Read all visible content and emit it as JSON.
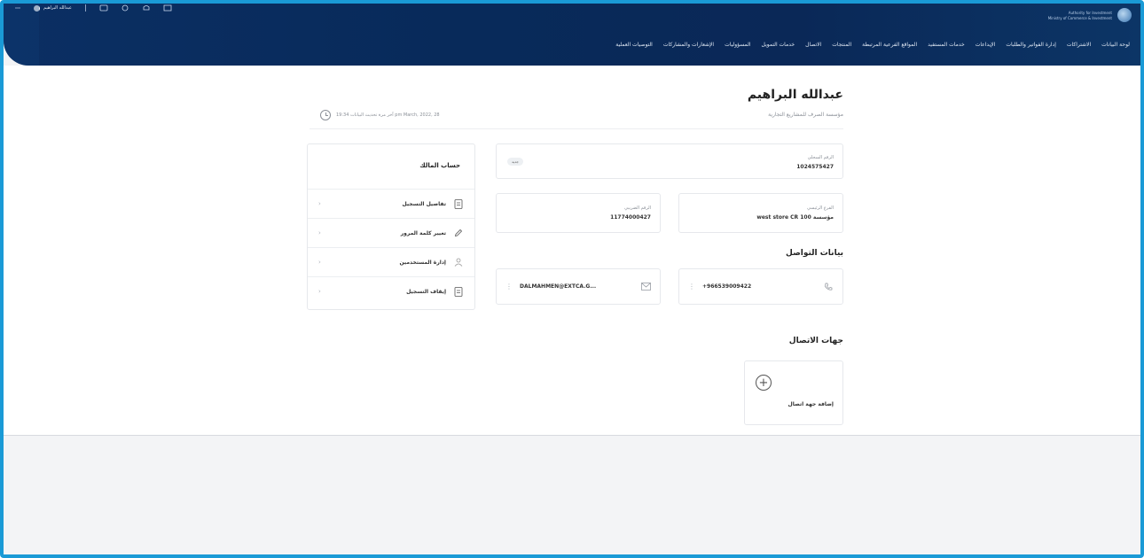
{
  "header": {
    "brand_lines": [
      "Authority for Investment",
      "Ministry of Commerce & Investment"
    ],
    "user_name": "عبدالله البراهيم",
    "nav": [
      "لوحة البيانات",
      "الاشتراكات",
      "إدارة الفواتير والطلبات",
      "الإيداعات",
      "خدمات المستفيد",
      "المواقع الفرعية المرتبطة",
      "المنتجات",
      "الاتصال",
      "خدمات التمويل",
      "المسؤوليات",
      "الإشعارات والمشاركات",
      "التوصيات العملية"
    ]
  },
  "page": {
    "title": "عبدالله البراهيم",
    "subtitle": "مؤسسة الصرف للمشاريع التجارية",
    "last_update": "آخر مرة تحديث البيانات 19:34 pm March, 2022, 28"
  },
  "registration": {
    "label": "الرقم السجلي",
    "value": "1024575427",
    "badge": "جديد"
  },
  "branch": {
    "label": "الفرع الرئيسي",
    "value": "مؤسسة west store CR 100"
  },
  "tax": {
    "label": "الرقم الضريبي",
    "value": "11774000427"
  },
  "contact": {
    "title": "بيانات التواصل",
    "phone": "+966539009422",
    "email": "DALMAHMEN@EXTCA.G..."
  },
  "contacts_section": {
    "title": "جهات الاتصال",
    "add_label": "إضافة جهة اتصال"
  },
  "account": {
    "title": "حساب المالك",
    "items": [
      "تفاصيل التسجيل",
      "تغيير كلمة المرور",
      "إدارة المستخدمين",
      "إيقاف التسجيل"
    ]
  }
}
